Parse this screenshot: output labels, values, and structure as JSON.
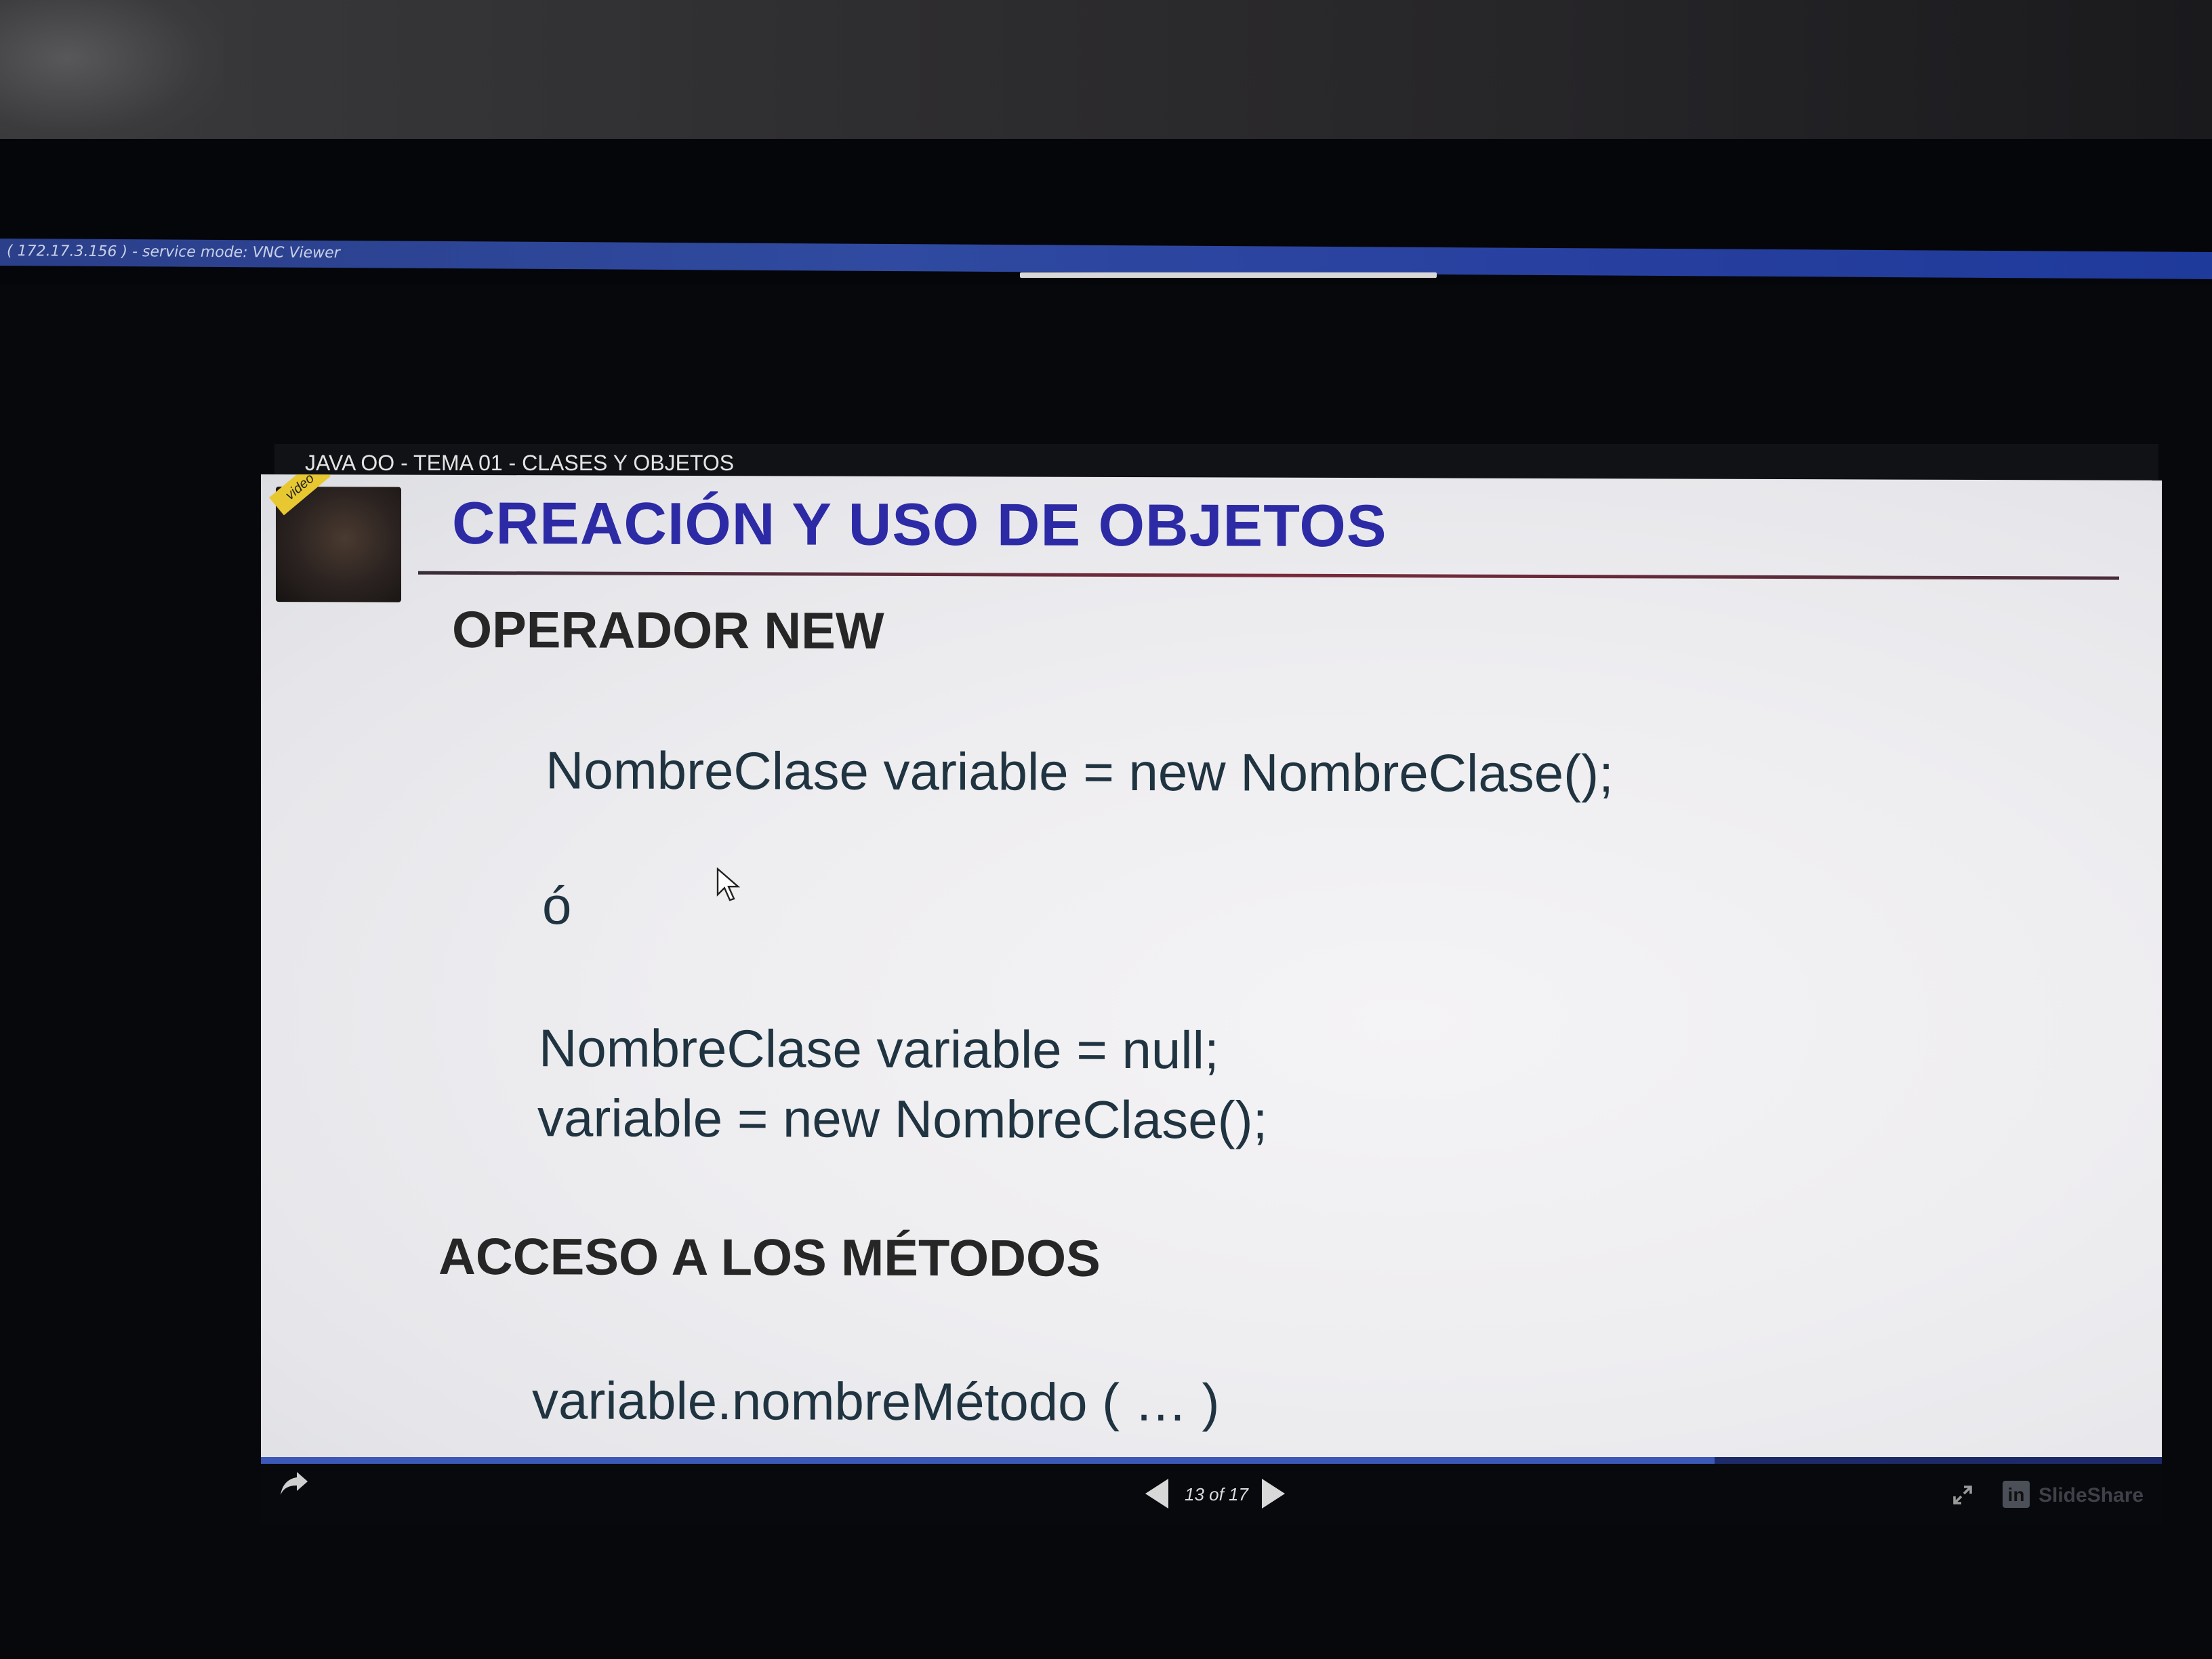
{
  "vnc_window": {
    "title": "( 172.17.3.156 ) - service mode: VNC Viewer"
  },
  "viewer": {
    "deck_title": "JAVA OO - TEMA 01 - CLASES Y OBJETOS",
    "video_badge": "video",
    "slide": {
      "title": "CREACIÓN Y USO DE OBJETOS",
      "section1_heading": "OPERADOR NEW",
      "code_line1": "NombreClase variable = new NombreClase();",
      "or_text": "ó",
      "code_line2": "NombreClase variable = null;",
      "code_line3": "variable = new NombreClase();",
      "section2_heading": "ACCESO A LOS MÉTODOS",
      "code_line4": "variable.nombreMétodo ( … )"
    },
    "controls": {
      "current_page": 13,
      "total_pages": 17,
      "page_label": "13 of 17",
      "share_icon": "share-arrow-icon",
      "prev_icon": "triangle-left-icon",
      "next_icon": "triangle-right-icon",
      "expand_icon": "expand-arrows-icon",
      "brand_icon": "linkedin-icon",
      "brand_icon_text": "in",
      "brand_text": "SlideShare"
    }
  },
  "colors": {
    "slide_title": "#2d2aa6",
    "code_text": "#1f3440",
    "heading_text": "#262626",
    "vnc_titlebar": "#2f4aa0"
  }
}
